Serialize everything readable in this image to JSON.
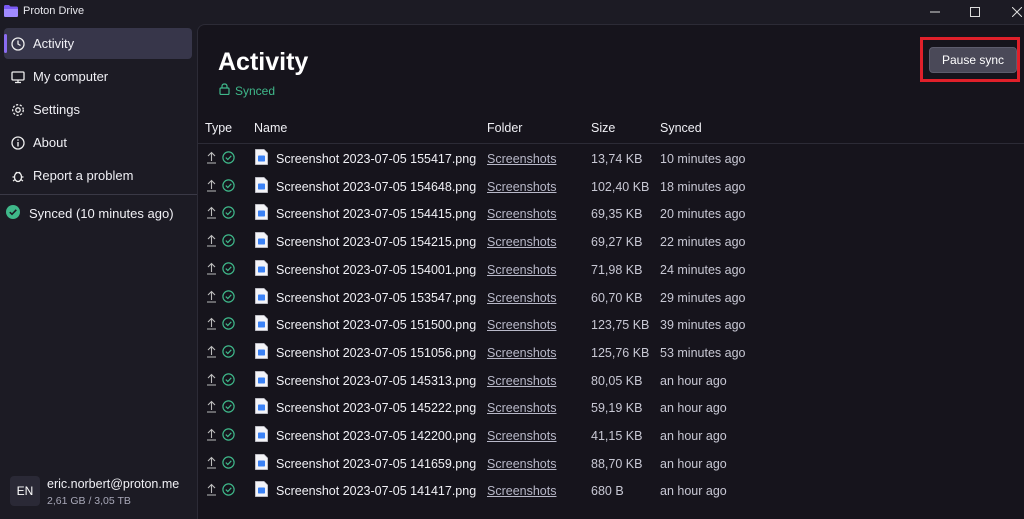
{
  "app": {
    "title": "Proton Drive"
  },
  "sidebar": {
    "items": [
      {
        "label": "Activity",
        "icon": "clock-icon",
        "active": true
      },
      {
        "label": "My computer",
        "icon": "monitor-icon",
        "active": false
      },
      {
        "label": "Settings",
        "icon": "gear-icon",
        "active": false
      },
      {
        "label": "About",
        "icon": "info-icon",
        "active": false
      },
      {
        "label": "Report a problem",
        "icon": "bug-icon",
        "active": false
      }
    ],
    "sync_status": "Synced (10 minutes ago)",
    "account": {
      "initials": "EN",
      "email": "eric.norbert@proton.me",
      "storage": "2,61 GB / 3,05 TB"
    }
  },
  "main": {
    "title": "Activity",
    "status": "Synced",
    "pause_button": "Pause sync",
    "columns": [
      "Type",
      "Name",
      "Folder",
      "Size",
      "Synced"
    ],
    "rows": [
      {
        "name": "Screenshot 2023-07-05 155417.png",
        "folder": "Screenshots",
        "size": "13,74 KB",
        "synced": "10 minutes ago"
      },
      {
        "name": "Screenshot 2023-07-05 154648.png",
        "folder": "Screenshots",
        "size": "102,40 KB",
        "synced": "18 minutes ago"
      },
      {
        "name": "Screenshot 2023-07-05 154415.png",
        "folder": "Screenshots",
        "size": "69,35 KB",
        "synced": "20 minutes ago"
      },
      {
        "name": "Screenshot 2023-07-05 154215.png",
        "folder": "Screenshots",
        "size": "69,27 KB",
        "synced": "22 minutes ago"
      },
      {
        "name": "Screenshot 2023-07-05 154001.png",
        "folder": "Screenshots",
        "size": "71,98 KB",
        "synced": "24 minutes ago"
      },
      {
        "name": "Screenshot 2023-07-05 153547.png",
        "folder": "Screenshots",
        "size": "60,70 KB",
        "synced": "29 minutes ago"
      },
      {
        "name": "Screenshot 2023-07-05 151500.png",
        "folder": "Screenshots",
        "size": "123,75 KB",
        "synced": "39 minutes ago"
      },
      {
        "name": "Screenshot 2023-07-05 151056.png",
        "folder": "Screenshots",
        "size": "125,76 KB",
        "synced": "53 minutes ago"
      },
      {
        "name": "Screenshot 2023-07-05 145313.png",
        "folder": "Screenshots",
        "size": "80,05 KB",
        "synced": "an hour ago"
      },
      {
        "name": "Screenshot 2023-07-05 145222.png",
        "folder": "Screenshots",
        "size": "59,19 KB",
        "synced": "an hour ago"
      },
      {
        "name": "Screenshot 2023-07-05 142200.png",
        "folder": "Screenshots",
        "size": "41,15 KB",
        "synced": "an hour ago"
      },
      {
        "name": "Screenshot 2023-07-05 141659.png",
        "folder": "Screenshots",
        "size": "88,70 KB",
        "synced": "an hour ago"
      },
      {
        "name": "Screenshot 2023-07-05 141417.png",
        "folder": "Screenshots",
        "size": "680 B",
        "synced": "an hour ago"
      }
    ]
  },
  "colors": {
    "accent": "#8b6cf2",
    "synced_green": "#3fb88a",
    "highlight_red": "#e0202a",
    "file_icon_blue": "#3b82f6"
  }
}
